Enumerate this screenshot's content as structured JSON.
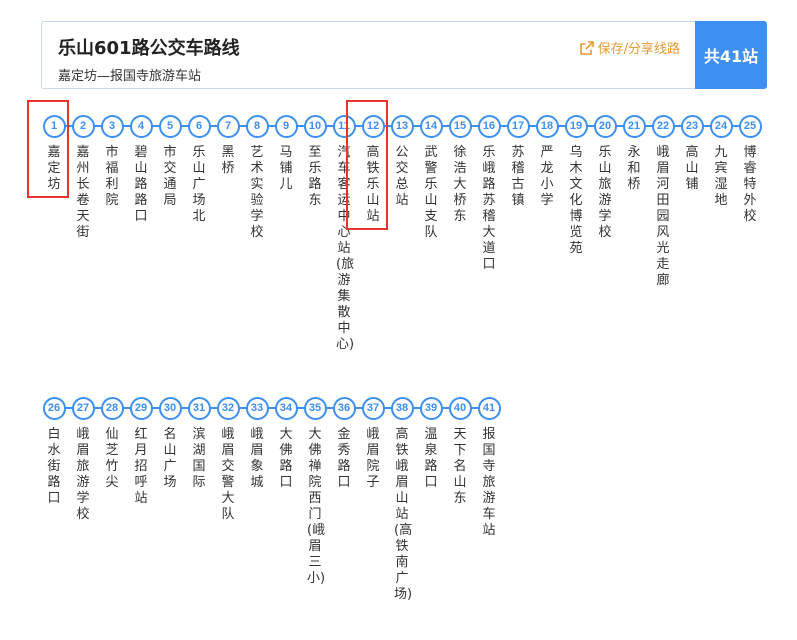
{
  "header": {
    "title": "乐山601路公交车路线",
    "subtitle": "嘉定坊—报国寺旅游车站",
    "share_label": "保存/分享线路",
    "share_icon": "external-link-icon",
    "stop_count": "共41站"
  },
  "colors": {
    "accent": "#3d8ff2",
    "share": "#e69a35",
    "highlight": "#e5362d"
  },
  "highlighted_stops": [
    "1",
    "12"
  ],
  "stops": [
    {
      "no": "1",
      "name": "嘉定坊"
    },
    {
      "no": "2",
      "name": "嘉州长卷天街"
    },
    {
      "no": "3",
      "name": "市福利院"
    },
    {
      "no": "4",
      "name": "碧山路路口"
    },
    {
      "no": "5",
      "name": "市交通局"
    },
    {
      "no": "6",
      "name": "乐山广场北"
    },
    {
      "no": "7",
      "name": "黑桥"
    },
    {
      "no": "8",
      "name": "艺术实验学校"
    },
    {
      "no": "9",
      "name": "马铺儿"
    },
    {
      "no": "10",
      "name": "至乐路东"
    },
    {
      "no": "11",
      "name": "汽车客运中心站(旅游集散中心)"
    },
    {
      "no": "12",
      "name": "高铁乐山站"
    },
    {
      "no": "13",
      "name": "公交总站"
    },
    {
      "no": "14",
      "name": "武警乐山支队"
    },
    {
      "no": "15",
      "name": "徐浩大桥东"
    },
    {
      "no": "16",
      "name": "乐峨路苏稽大道口"
    },
    {
      "no": "17",
      "name": "苏稽古镇"
    },
    {
      "no": "18",
      "name": "严龙小学"
    },
    {
      "no": "19",
      "name": "乌木文化博览苑"
    },
    {
      "no": "20",
      "name": "乐山旅游学校"
    },
    {
      "no": "21",
      "name": "永和桥"
    },
    {
      "no": "22",
      "name": "峨眉河田园风光走廊"
    },
    {
      "no": "23",
      "name": "高山铺"
    },
    {
      "no": "24",
      "name": "九宾湿地"
    },
    {
      "no": "25",
      "name": "博睿特外校"
    },
    {
      "no": "26",
      "name": "白水街路口"
    },
    {
      "no": "27",
      "name": "峨眉旅游学校"
    },
    {
      "no": "28",
      "name": "仙芝竹尖"
    },
    {
      "no": "29",
      "name": "红月招呼站"
    },
    {
      "no": "30",
      "name": "名山广场"
    },
    {
      "no": "31",
      "name": "滨湖国际"
    },
    {
      "no": "32",
      "name": "峨眉交警大队"
    },
    {
      "no": "33",
      "name": "峨眉象城"
    },
    {
      "no": "34",
      "name": "大佛路口"
    },
    {
      "no": "35",
      "name": "大佛禅院西门(峨眉三小)"
    },
    {
      "no": "36",
      "name": "金秀路口"
    },
    {
      "no": "37",
      "name": "峨眉院子"
    },
    {
      "no": "38",
      "name": "高铁峨眉山站(高铁南广场)"
    },
    {
      "no": "39",
      "name": "温泉路口"
    },
    {
      "no": "40",
      "name": "天下名山东"
    },
    {
      "no": "41",
      "name": "报国寺旅游车站"
    }
  ]
}
